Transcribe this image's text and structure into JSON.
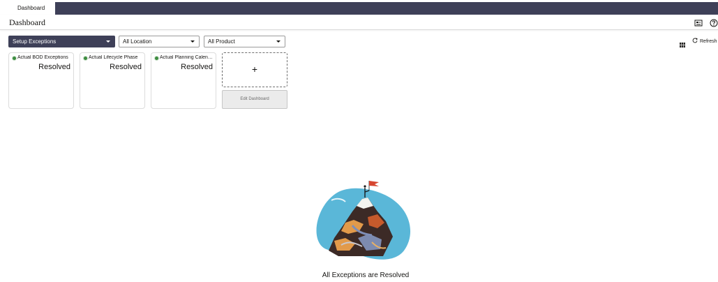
{
  "tabs": [
    {
      "label": "Dashboard"
    }
  ],
  "page": {
    "title": "Dashboard"
  },
  "header_icons": [
    "dashboard-view-icon",
    "help-icon"
  ],
  "filters": {
    "exception_type": "Setup Exceptions",
    "location": "All Location",
    "product": "All Product"
  },
  "toolbar": {
    "refresh_label": "Refresh",
    "icons": [
      "grid-view-icon",
      "refresh-icon"
    ]
  },
  "tiles": [
    {
      "name": "Actual BOD Exceptions",
      "status": "Resolved",
      "status_color": "#3d8c40"
    },
    {
      "name": "Actual Lifecycle Phase",
      "status": "Resolved",
      "status_color": "#3d8c40"
    },
    {
      "name": "Actual Planning Calendar",
      "status": "Resolved",
      "status_color": "#3d8c40"
    }
  ],
  "add_tile": {
    "label": "+"
  },
  "edit_dashboard": {
    "label": "Edit Dashboard"
  },
  "empty_state": {
    "message": "All Exceptions are Resolved",
    "illustration": "mountain-flag-illustration"
  },
  "colors": {
    "primary": "#3e4058",
    "accent_flag": "#d6452f",
    "sky": "#5ab7d8"
  }
}
